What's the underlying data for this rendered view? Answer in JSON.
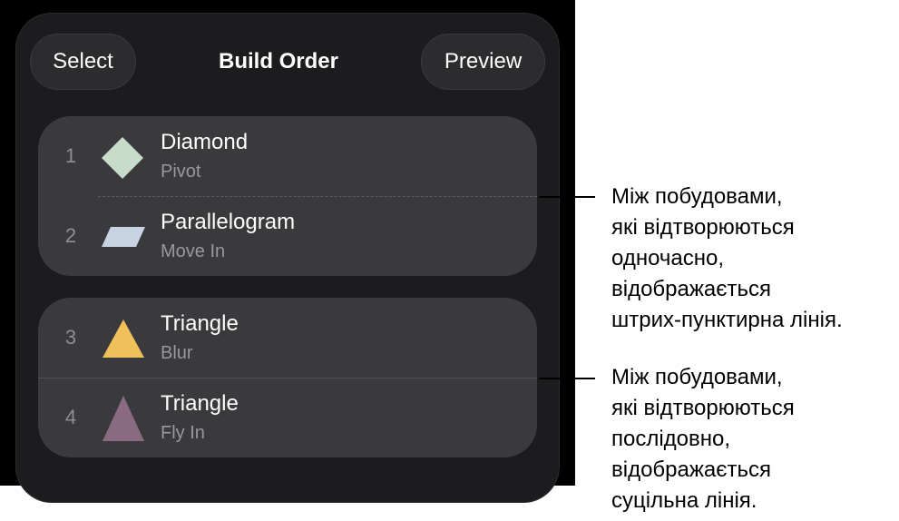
{
  "header": {
    "select_label": "Select",
    "title": "Build Order",
    "preview_label": "Preview"
  },
  "builds": [
    {
      "number": "1",
      "name": "Diamond",
      "effect": "Pivot",
      "shape": "diamond",
      "color": "#c8dccb"
    },
    {
      "number": "2",
      "name": "Parallelogram",
      "effect": "Move In",
      "shape": "parallelogram",
      "color": "#c8d4e4"
    },
    {
      "number": "3",
      "name": "Triangle",
      "effect": "Blur",
      "shape": "triangle",
      "color": "#f0c05a"
    },
    {
      "number": "4",
      "name": "Triangle",
      "effect": "Fly In",
      "shape": "triangle",
      "color": "#8a6a80"
    }
  ],
  "callouts": [
    {
      "lines": [
        "Між побудовами,",
        "які відтворюються",
        "одночасно,",
        "відображається",
        "штрих-пунктирна лінія."
      ]
    },
    {
      "lines": [
        "Між побудовами,",
        "які відтворюються",
        "послідовно,",
        "відображається",
        "суцільна лінія."
      ]
    }
  ]
}
